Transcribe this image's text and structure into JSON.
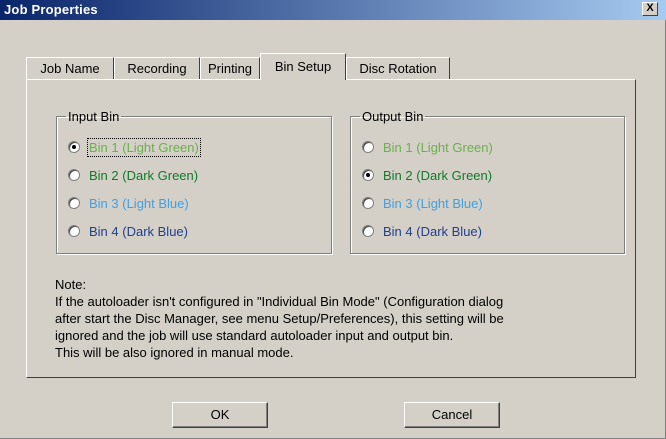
{
  "window": {
    "title": "Job Properties",
    "close_glyph": "X"
  },
  "tabs": [
    {
      "label": "Job Name",
      "active": false
    },
    {
      "label": "Recording",
      "active": false
    },
    {
      "label": "Printing",
      "active": false
    },
    {
      "label": "Bin Setup",
      "active": true
    },
    {
      "label": "Disc Rotation",
      "active": false
    }
  ],
  "input_bin": {
    "legend": "Input Bin",
    "options": [
      {
        "label": "Bin 1 (Light Green)",
        "checked": true,
        "color": "#6ab04c"
      },
      {
        "label": "Bin 2 (Dark Green)",
        "checked": false,
        "color": "#0f7a2a"
      },
      {
        "label": "Bin 3 (Light Blue)",
        "checked": false,
        "color": "#3fa0e6"
      },
      {
        "label": "Bin 4 (Dark Blue)",
        "checked": false,
        "color": "#1f3f8f"
      }
    ]
  },
  "output_bin": {
    "legend": "Output Bin",
    "options": [
      {
        "label": "Bin 1 (Light Green)",
        "checked": false,
        "color": "#6ab04c"
      },
      {
        "label": "Bin 2 (Dark Green)",
        "checked": true,
        "color": "#0f7a2a"
      },
      {
        "label": "Bin 3 (Light Blue)",
        "checked": false,
        "color": "#3fa0e6"
      },
      {
        "label": "Bin 4 (Dark Blue)",
        "checked": false,
        "color": "#1f3f8f"
      }
    ]
  },
  "note": {
    "heading": "Note:",
    "line1": "If the autoloader isn't configured in \"Individual Bin Mode\" (Configuration dialog",
    "line2": "after start the Disc Manager, see menu Setup/Preferences), this setting will be",
    "line3": "ignored and the job will use standard autoloader input and output bin.",
    "line4": "This will be also ignored in manual mode."
  },
  "buttons": {
    "ok": "OK",
    "cancel": "Cancel"
  }
}
